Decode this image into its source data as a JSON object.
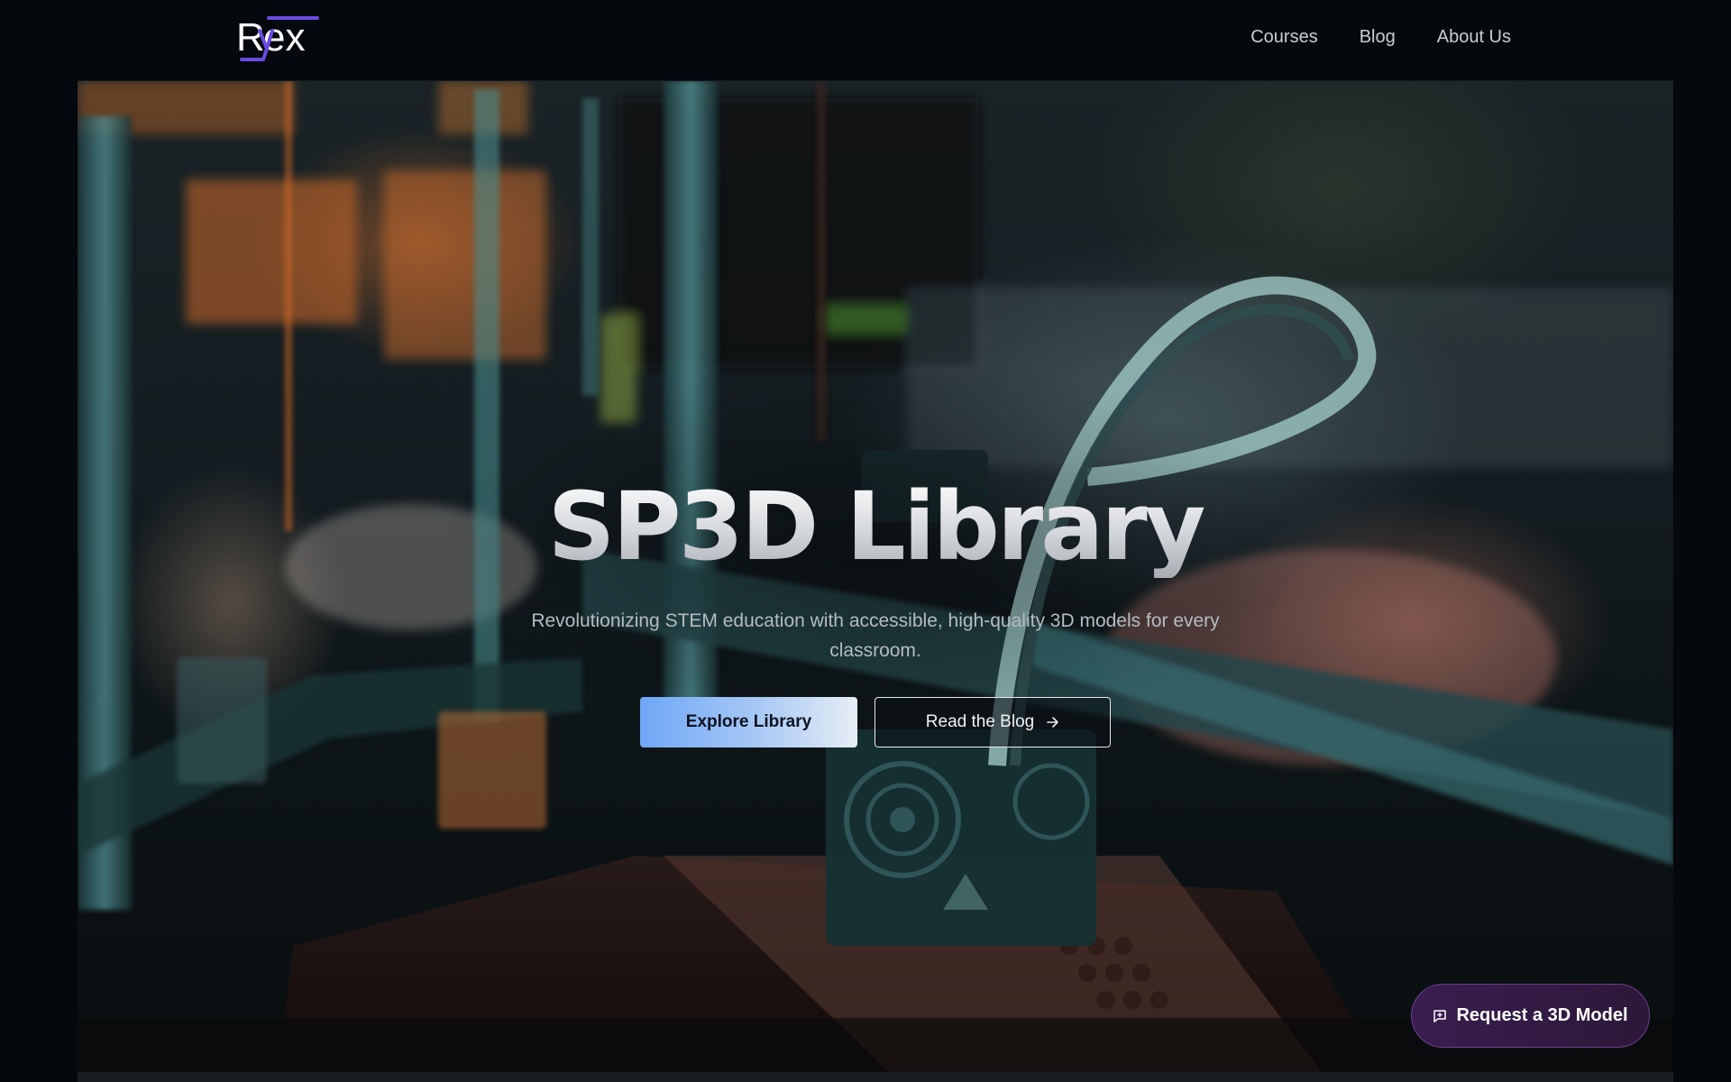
{
  "nav": {
    "logo_text": "Ryex",
    "links": [
      {
        "label": "Courses"
      },
      {
        "label": "Blog"
      },
      {
        "label": "About Us"
      }
    ]
  },
  "hero": {
    "title": "SP3D Library",
    "subtitle": "Revolutionizing STEM education with accessible, high-quality 3D models for every classroom.",
    "primary_button": "Explore Library",
    "secondary_button": "Read the Blog"
  },
  "floating_button": {
    "label": "Request a 3D Model",
    "icon": "chat-plus-icon"
  },
  "colors": {
    "background": "#05080c",
    "accent_blue": "#6ea7f6",
    "accent_purple": "#3a1d4f",
    "logo_purple": "#5b3fd6"
  }
}
